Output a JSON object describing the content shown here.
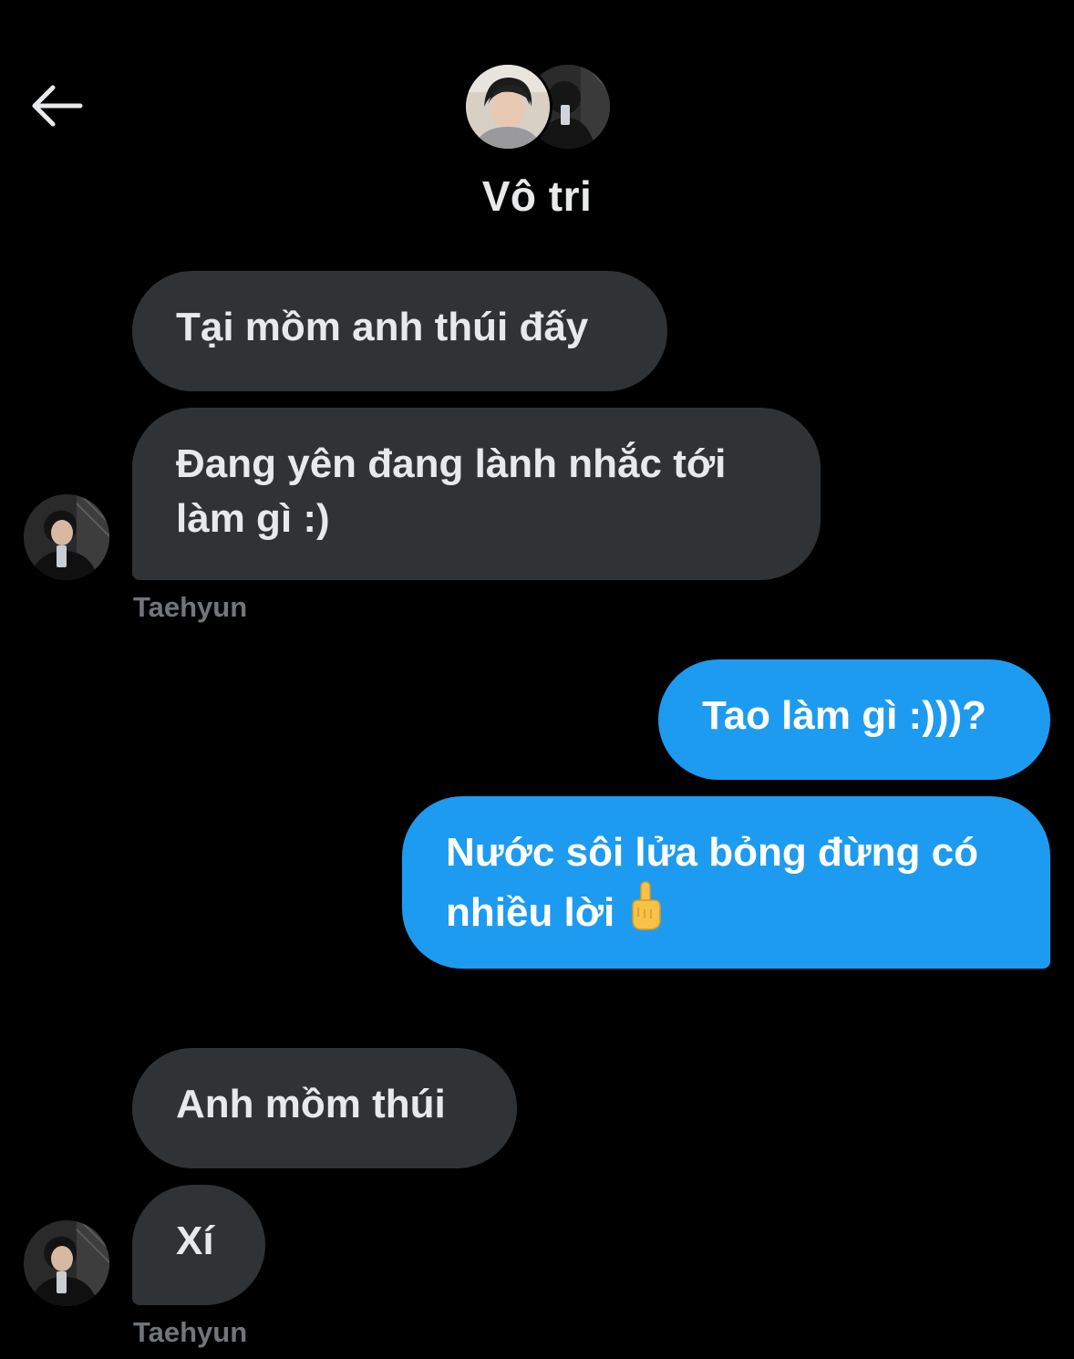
{
  "header": {
    "title": "Vô tri"
  },
  "messages": [
    {
      "direction": "in",
      "text": "Tại mồm anh thúi đấy"
    },
    {
      "direction": "in",
      "line1": "Đang yên đang lành nhắc tới",
      "line2": "làm gì :)"
    },
    {
      "direction": "out",
      "text": "Tao làm gì :)))?"
    },
    {
      "direction": "out",
      "line1": "Nước sôi lửa bỏng đừng có",
      "line2": "nhiều lời"
    },
    {
      "direction": "in",
      "text": "Anh mồm thúi"
    },
    {
      "direction": "in",
      "text": "Xí"
    }
  ],
  "senders": {
    "first": "Taehyun",
    "second": "Taehyun"
  },
  "icons": {
    "back": "arrow-left-icon",
    "emoji": "middle-finger-emoji"
  },
  "colors": {
    "background": "#000000",
    "incoming_bubble": "#2f3336",
    "outgoing_bubble": "#1d9bf0",
    "muted_text": "#71767b"
  }
}
